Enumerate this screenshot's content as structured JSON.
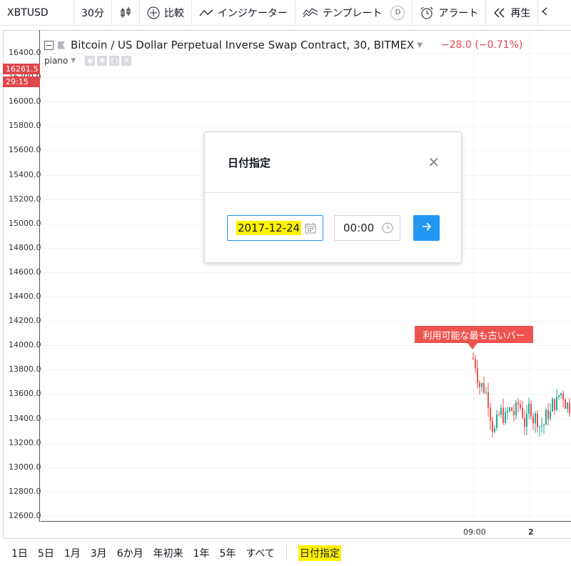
{
  "toolbar": {
    "symbol": "XBTUSD",
    "interval": "30分",
    "compare": "比較",
    "indicators": "インジケーター",
    "templates": "テンプレート",
    "templates_badge": "D",
    "alert": "アラート",
    "replay": "再生"
  },
  "legend": {
    "title": "Bitcoin / US Dollar Perpetual Inverse Swap Contract, 30, BITMEX",
    "change": "−28.0 (−0.71%)",
    "indicator": "piano"
  },
  "price_axis": {
    "ticks": [
      "16400.0",
      "16200.0",
      "16000.0",
      "15800.0",
      "15600.0",
      "15400.0",
      "15200.0",
      "15000.0",
      "14800.0",
      "14600.0",
      "14400.0",
      "14200.0",
      "14000.0",
      "13800.0",
      "13600.0",
      "13400.0",
      "13200.0",
      "13000.0",
      "12800.0",
      "12600.0"
    ],
    "last_price": "16261.5",
    "countdown": "29:15"
  },
  "time_axis": {
    "labels": [
      "09:00",
      "2"
    ]
  },
  "dialog": {
    "title": "日付指定",
    "date_value": "2017-12-24",
    "time_value": "00:00"
  },
  "chart": {
    "oldest_bar_label": "利用可能な最も古いバー",
    "up_color": "#26a69a",
    "down_color": "#ef5350"
  },
  "bottom": {
    "ranges": [
      "1日",
      "5日",
      "1月",
      "3月",
      "6か月",
      "年初来",
      "1年",
      "5年",
      "すべて"
    ],
    "goto_label": "日付指定"
  }
}
